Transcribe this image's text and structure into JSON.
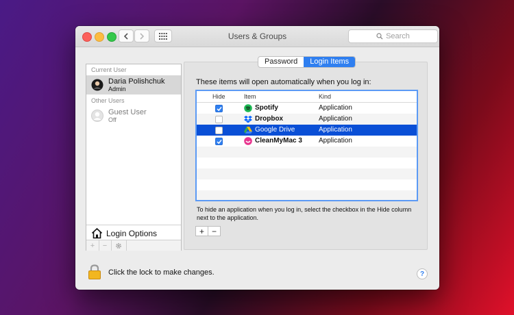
{
  "window": {
    "title": "Users & Groups",
    "search_placeholder": "Search"
  },
  "sidebar": {
    "current_user_header": "Current User",
    "current_user": {
      "name": "Daria Polishchuk",
      "role": "Admin"
    },
    "other_users_header": "Other Users",
    "other_users": [
      {
        "name": "Guest User",
        "status": "Off"
      }
    ],
    "login_options_label": "Login Options",
    "tools": [
      "+",
      "−",
      "gear-icon"
    ]
  },
  "tabs": [
    {
      "label": "Password",
      "active": false
    },
    {
      "label": "Login Items",
      "active": true
    }
  ],
  "login_items": {
    "intro": "These items will open automatically when you log in:",
    "columns": {
      "hide": "Hide",
      "item": "Item",
      "kind": "Kind"
    },
    "rows": [
      {
        "name": "Spotify",
        "kind": "Application",
        "hide": true,
        "icon": "spotify-icon",
        "color": "#1db954"
      },
      {
        "name": "Dropbox",
        "kind": "Application",
        "hide": false,
        "icon": "dropbox-icon",
        "color": "#0061ff"
      },
      {
        "name": "Google Drive",
        "kind": "Application",
        "hide": false,
        "icon": "google-drive-icon",
        "color": "#34a853",
        "selected": true
      },
      {
        "name": "CleanMyMac 3",
        "kind": "Application",
        "hide": true,
        "icon": "cleanmymac-icon",
        "color": "#e8368f"
      }
    ],
    "hint": "To hide an application when you log in, select the checkbox in the Hide column next to the application.",
    "add_label": "+",
    "remove_label": "−"
  },
  "footer": {
    "lock_text": "Click the lock to make changes.",
    "help_label": "?"
  },
  "colors": {
    "accent": "#2f7ff0",
    "selection": "#0a4fd6"
  }
}
